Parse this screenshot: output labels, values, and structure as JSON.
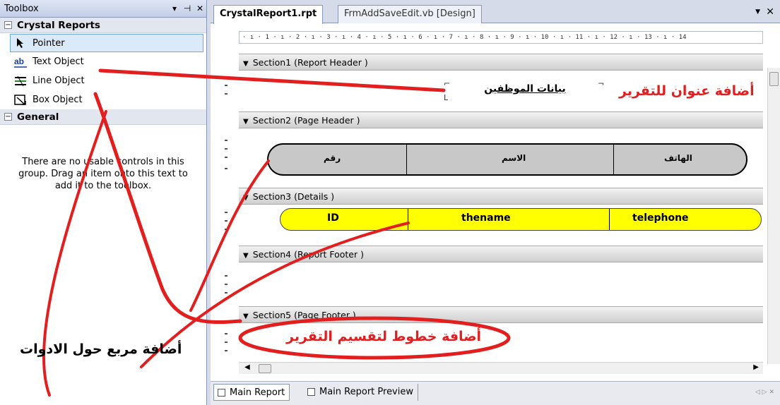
{
  "toolbox": {
    "title": "Toolbox",
    "pin_glyph": "▾ ⊣",
    "close_glyph": "✕",
    "groups": [
      {
        "name": "Crystal Reports",
        "toggle": "⊟",
        "items": [
          {
            "label": "Pointer",
            "icon": "pointer-icon"
          },
          {
            "label": "Text Object",
            "icon": "text-object-icon"
          },
          {
            "label": "Line Object",
            "icon": "line-object-icon"
          },
          {
            "label": "Box Object",
            "icon": "box-object-icon"
          }
        ]
      },
      {
        "name": "General",
        "toggle": "⊟",
        "empty_text": "There are no usable controls in this group. Drag an item onto this text to add it to the toolbox."
      }
    ]
  },
  "editor": {
    "tabs": [
      {
        "label": "CrystalReport1.rpt",
        "active": true
      },
      {
        "label": "FrmAddSaveEdit.vb [Design]",
        "active": false
      }
    ],
    "ruler_text": "· ı · 1 · ı · 2 · ı · 3 · ı · 4 · ı · 5 · ı · 6 · ı · 7 · ı · 8 · ı · 9 · ı · 10 · ı · 11 · ı · 12 · ı · 13 · ı · 14",
    "sections": [
      {
        "label": "Section1 (Report Header )"
      },
      {
        "label": "Section2 (Page Header )"
      },
      {
        "label": "Section3 (Details )"
      },
      {
        "label": "Section4 (Report Footer )"
      },
      {
        "label": "Section5 (Page Footer )"
      }
    ],
    "report_title": "بيانات الموظفين",
    "page_header_fields": {
      "phone": "الهاتف",
      "name": "الاسم",
      "number": "رقم"
    },
    "detail_fields": {
      "id": "ID",
      "name": "thename",
      "phone": "telephone"
    }
  },
  "bottom_tabs": [
    {
      "label": "Main Report",
      "active": true
    },
    {
      "label": "Main Report Preview",
      "active": false
    }
  ],
  "annotations": {
    "add_title": "أضافة عنوان للتقرير",
    "add_lines": "أضافة خطوط لتقسيم التقرير",
    "add_box": "أضافة مربع حول الادوات"
  },
  "colors": {
    "annotation_red": "#e31e1e",
    "details_fill": "#ffff00",
    "header_fill": "#c8c8c8",
    "selection": "#dbeaf9"
  }
}
